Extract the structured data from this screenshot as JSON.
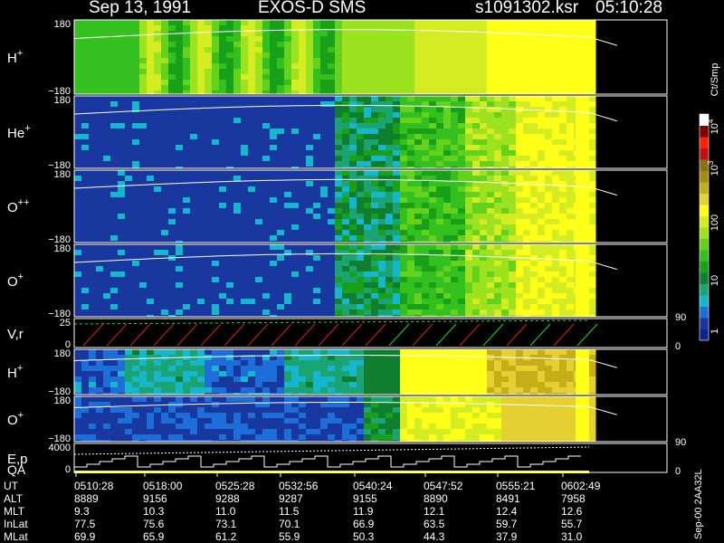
{
  "header": {
    "date": "Sep 13, 1991",
    "instrument": "EXOS-D SMS",
    "file": "s1091302.ksr",
    "time": "05:10:28"
  },
  "colorbar": {
    "unit": "Ct/Smp",
    "tick_labels": [
      "1",
      "10",
      "100",
      "10",
      "10"
    ],
    "exponents": [
      "",
      "",
      "",
      "3",
      "4"
    ],
    "colors": [
      "#10208c",
      "#1838a0",
      "#1d6ed8",
      "#16b7cc",
      "#1aa474",
      "#0f7f2f",
      "#18a018",
      "#34c01e",
      "#64d21c",
      "#9ce21e",
      "#d4ec22",
      "#ffff18",
      "#e4d030",
      "#c6ae1a",
      "#a48c10",
      "#8a7018",
      "#c01010",
      "#ff2000",
      "#7c0000",
      "#ffffff"
    ]
  },
  "panels": [
    {
      "label": "H",
      "charge": "+",
      "ymax": "180",
      "ymin": "−180"
    },
    {
      "label": "He",
      "charge": "+",
      "ymax": "180",
      "ymin": "−180"
    },
    {
      "label": "O",
      "charge": "++",
      "ymax": "180",
      "ymin": "−180"
    },
    {
      "label": "O",
      "charge": "+",
      "ymax": "180",
      "ymin": "−180"
    },
    {
      "label": "V,r",
      "charge": "",
      "ymax": "25",
      "ymin": "0",
      "right_max": "90",
      "right_min": "0"
    },
    {
      "label": "H",
      "charge": "+",
      "ymax": "180",
      "ymin": "−180"
    },
    {
      "label": "O",
      "charge": "+",
      "ymax": "180",
      "ymin": "−180"
    },
    {
      "label": "E,p",
      "label2": "QA",
      "charge": "",
      "ymax": "4000",
      "ymin": "0",
      "right_max": "90",
      "right_min": "0"
    }
  ],
  "orbit_table": {
    "rows": [
      {
        "name": "UT",
        "values": [
          "0510:28",
          "0518:00",
          "0525:28",
          "0532:56",
          "0540:24",
          "0547:52",
          "0555:21",
          "0602:49"
        ]
      },
      {
        "name": "ALT",
        "values": [
          "8889",
          "9156",
          "9288",
          "9287",
          "9155",
          "8890",
          "8491",
          "7958"
        ]
      },
      {
        "name": "MLT",
        "values": [
          "9.3",
          "10.3",
          "11.0",
          "11.5",
          "11.9",
          "12.1",
          "12.4",
          "12.6"
        ]
      },
      {
        "name": "InLat",
        "values": [
          "77.5",
          "75.6",
          "73.1",
          "70.1",
          "66.9",
          "63.5",
          "59.7",
          "55.7"
        ]
      },
      {
        "name": "MLat",
        "values": [
          "69.9",
          "65.9",
          "61.2",
          "55.9",
          "50.3",
          "44.3",
          "37.9",
          "31.0"
        ]
      }
    ]
  },
  "footer": {
    "version": "Sep-00 2AA32L"
  },
  "theme": {
    "background": "#000000",
    "axis": "#ffffff",
    "green_line": "#20e020",
    "red_line": "#e02020"
  }
}
